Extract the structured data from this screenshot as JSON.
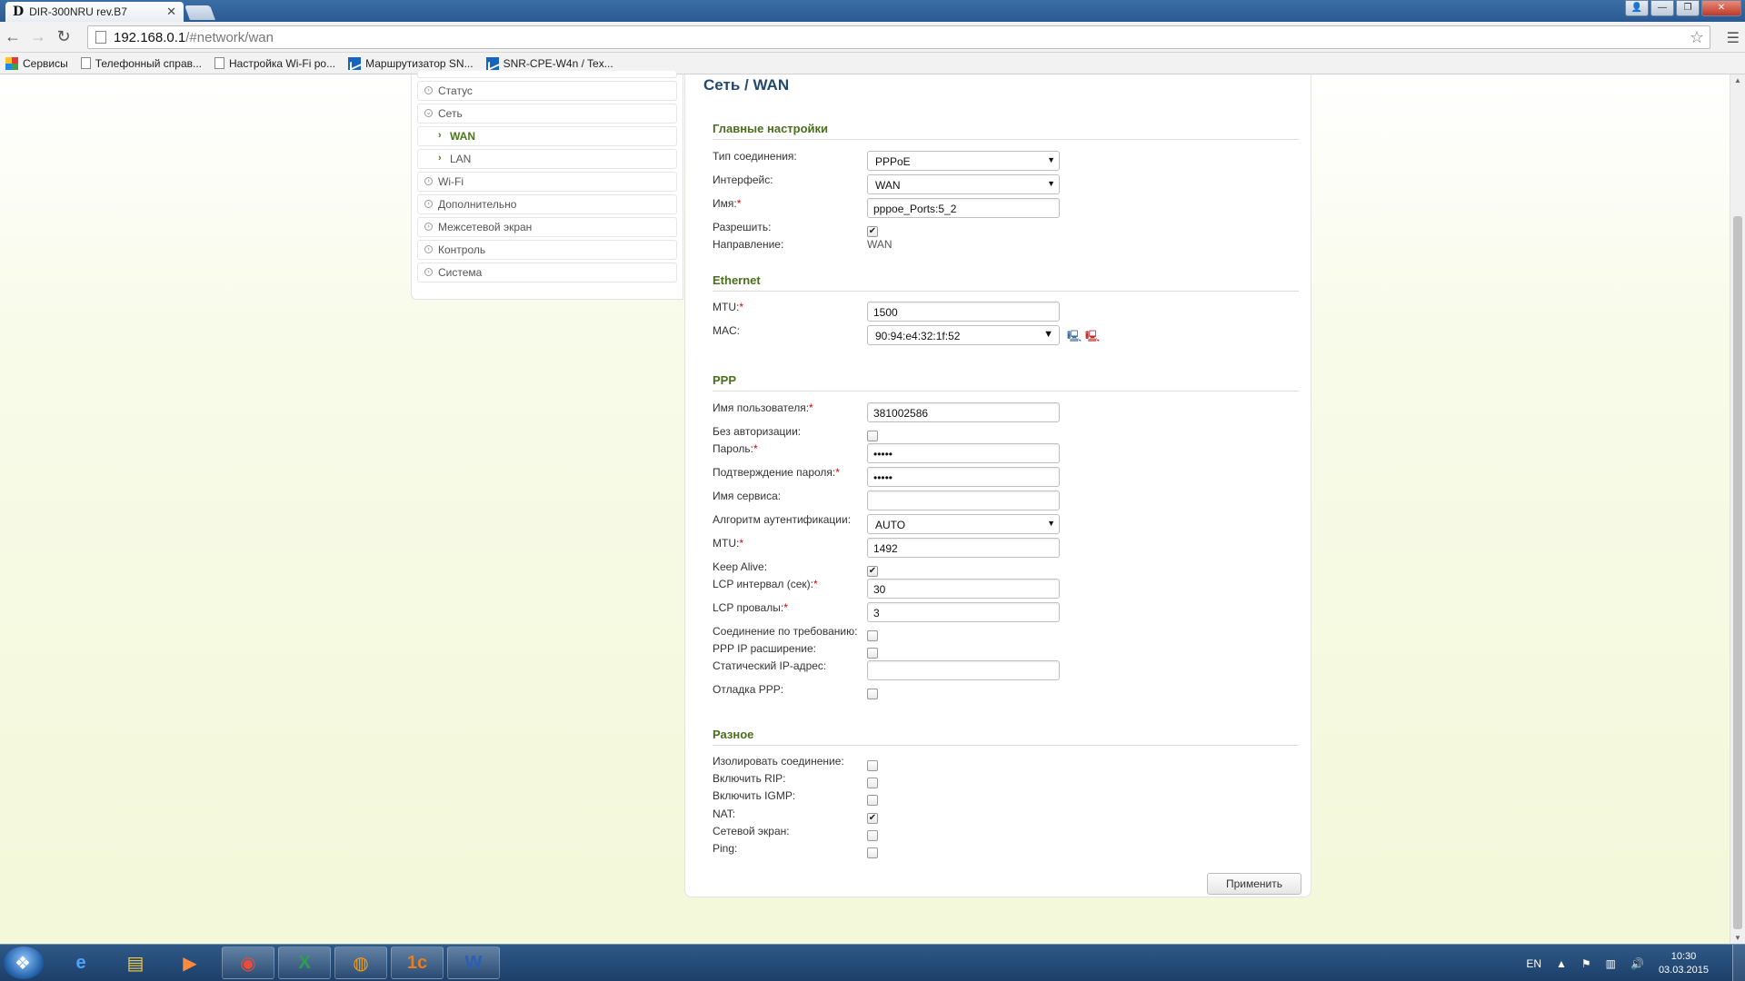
{
  "browser": {
    "tab_title": "DIR-300NRU rev.B7",
    "tab_logo": "D",
    "url_host": "192.168.0.1",
    "url_path": "/#network/wan"
  },
  "bookmarks": [
    {
      "label": "Сервисы",
      "icon": "apps-icon"
    },
    {
      "label": "Телефонный справ...",
      "icon": "page-icon"
    },
    {
      "label": "Настройка Wi-Fi ро...",
      "icon": "page-icon"
    },
    {
      "label": "Маршрутизатор SN...",
      "icon": "chart-icon"
    },
    {
      "label": "SNR-CPE-W4n / Tex...",
      "icon": "chart-icon"
    }
  ],
  "sidebar": {
    "items": [
      {
        "label": "Статус",
        "type": "top",
        "active": false
      },
      {
        "label": "Сеть",
        "type": "top",
        "active": false,
        "expanded": true
      },
      {
        "label": "WAN",
        "type": "sub",
        "active": true
      },
      {
        "label": "LAN",
        "type": "sub",
        "active": false
      },
      {
        "label": "Wi-Fi",
        "type": "top",
        "active": false
      },
      {
        "label": "Дополнительно",
        "type": "top",
        "active": false
      },
      {
        "label": "Межсетевой экран",
        "type": "top",
        "active": false
      },
      {
        "label": "Контроль",
        "type": "top",
        "active": false
      },
      {
        "label": "Система",
        "type": "top",
        "active": false
      }
    ]
  },
  "main": {
    "title": "Сеть /  WAN",
    "sections": {
      "general": {
        "title": "Главные настройки",
        "connection_type_label": "Тип соединения:",
        "connection_type_value": "PPPoE",
        "interface_label": "Интерфейс:",
        "interface_value": "WAN",
        "name_label": "Имя:",
        "name_value": "pppoe_Ports:5_2",
        "enable_label": "Разрешить:",
        "enable_checked": true,
        "direction_label": "Направление:",
        "direction_value": "WAN"
      },
      "ethernet": {
        "title": "Ethernet",
        "mtu_label": "MTU:",
        "mtu_value": "1500",
        "mac_label": "MAC:",
        "mac_value": "90:94:e4:32:1f:52"
      },
      "ppp": {
        "title": "PPP",
        "username_label": "Имя пользователя:",
        "username_value": "381002586",
        "no_auth_label": "Без авторизации:",
        "no_auth_checked": false,
        "password_label": "Пароль:",
        "password_value": "•••••",
        "password_confirm_label": "Подтверждение пароля:",
        "password_confirm_value": "•••••",
        "service_name_label": "Имя сервиса:",
        "service_name_value": "",
        "auth_algo_label": "Алгоритм аутентификации:",
        "auth_algo_value": "AUTO",
        "mtu_label": "MTU:",
        "mtu_value": "1492",
        "keepalive_label": "Keep Alive:",
        "keepalive_checked": true,
        "lcp_interval_label": "LCP интервал (сек):",
        "lcp_interval_value": "30",
        "lcp_fails_label": "LCP провалы:",
        "lcp_fails_value": "3",
        "on_demand_label": "Соединение по требованию:",
        "on_demand_checked": false,
        "ppp_ip_ext_label": "PPP IP расширение:",
        "ppp_ip_ext_checked": false,
        "static_ip_label": "Статический IP-адрес:",
        "static_ip_value": "",
        "ppp_debug_label": "Отладка PPP:",
        "ppp_debug_checked": false
      },
      "misc": {
        "title": "Разное",
        "isolate_label": "Изолировать соединение:",
        "isolate_checked": false,
        "rip_label": "Включить RIP:",
        "rip_checked": false,
        "igmp_label": "Включить IGMP:",
        "igmp_checked": false,
        "nat_label": "NAT:",
        "nat_checked": true,
        "firewall_label": "Сетевой экран:",
        "firewall_checked": false,
        "ping_label": "Ping:",
        "ping_checked": false
      }
    },
    "apply_label": "Применить",
    "required_mark": "*"
  },
  "taskbar": {
    "lang": "EN",
    "time": "10:30",
    "date": "03.03.2015",
    "apps": [
      "ie-icon",
      "explorer-icon",
      "media-player-icon",
      "chrome-icon",
      "excel-icon",
      "app-icon",
      "1c-icon",
      "word-icon"
    ]
  }
}
